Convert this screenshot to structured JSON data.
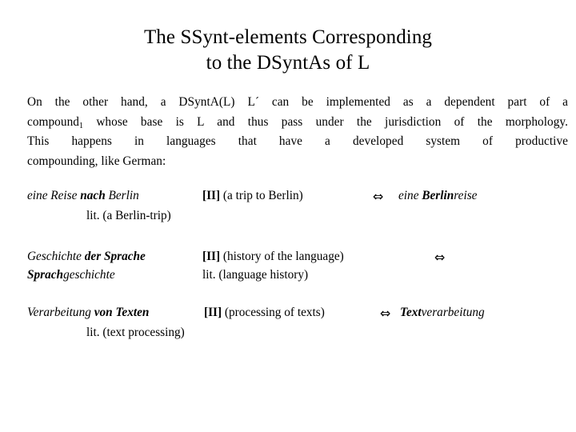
{
  "slide": {
    "title": {
      "line1": "The SSynt-elements Corresponding",
      "line2": "to the DSyntAs of L"
    },
    "body": {
      "line1": "On the other hand, a DSyntA(L) L´ can be implemented as a dependent part of a",
      "line2_before_sub": "compound",
      "line2_sub": "1",
      "line2_after_sub": " whose base is L and thus pass under the jurisdiction of the morphology.",
      "line3": "This happens in languages that have a developed system of productive",
      "line4": "compounding, like German:"
    },
    "examples": [
      {
        "source_plain_1": "eine Reise ",
        "source_bold": "nach",
        "source_plain_2": " Berlin",
        "gloss": "[II] (a trip to Berlin)",
        "arrow": "⇔",
        "target_plain_1": "eine ",
        "target_bold": "Berlin",
        "target_plain_2": "reise",
        "literal": "lit. (a Berlin-trip)"
      },
      {
        "source_plain_1": "Geschichte ",
        "source_bold": "der Sprache",
        "source_plain_2": "",
        "gloss": "[II] (history of the language)",
        "arrow": "⇔",
        "target_plain_1": "",
        "target_bold": "Sprach",
        "target_plain_2": "geschichte",
        "literal": "lit. (language history)"
      },
      {
        "source_plain_1": "Verarbeitung ",
        "source_bold": "von Texten",
        "source_plain_2": "",
        "gloss": "[II] (processing of texts)",
        "arrow": "⇔",
        "target_plain_1": "",
        "target_bold": "Text",
        "target_plain_2": "verarbeitung",
        "literal": "lit. (text processing)"
      }
    ],
    "colors": {
      "background": "#ffffff",
      "text": "#000000"
    }
  }
}
